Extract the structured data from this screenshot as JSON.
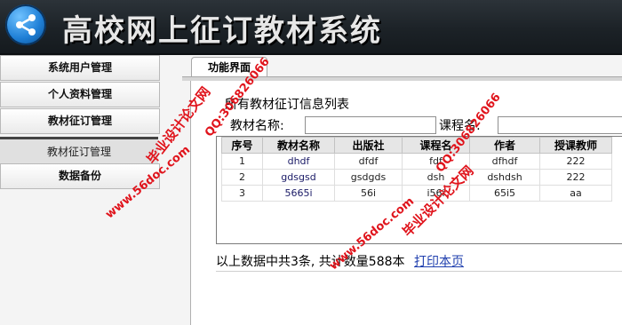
{
  "header": {
    "title": "高校网上征订教材系统",
    "logo": "share-icon"
  },
  "sidebar": {
    "items": [
      {
        "label": "系统用户管理"
      },
      {
        "label": "个人资料管理"
      },
      {
        "label": "教材征订管理"
      },
      {
        "label": "教材征订管理"
      },
      {
        "label": "数据备份"
      }
    ]
  },
  "main": {
    "tab_label": "功能界面",
    "list_title": "所有教材征订信息列表",
    "search": {
      "book_name_label": "教材名称:",
      "course_name_label": "课程名:"
    },
    "table": {
      "headers": [
        "序号",
        "教材名称",
        "出版社",
        "课程名",
        "作者",
        "授课教师"
      ],
      "rows": [
        [
          "1",
          "dhdf",
          "dfdf",
          "fdf",
          "dfhdf",
          "222"
        ],
        [
          "2",
          "gdsgsd",
          "gsdgds",
          "dsh",
          "dshdsh",
          "222"
        ],
        [
          "3",
          "5665i",
          "56i",
          "i56i",
          "65i5",
          "aa"
        ]
      ]
    },
    "summary_text": "以上数据中共3条, 共计数量588本",
    "print_link": "打印本页"
  },
  "watermarks": {
    "qq": "QQ:306826066",
    "site_a": "毕业设计论文网",
    "site_b": "www.56doc.com"
  },
  "colors": {
    "watermark": "#e0141c",
    "header_bg": "#1c2227",
    "link": "#1f3fae"
  }
}
